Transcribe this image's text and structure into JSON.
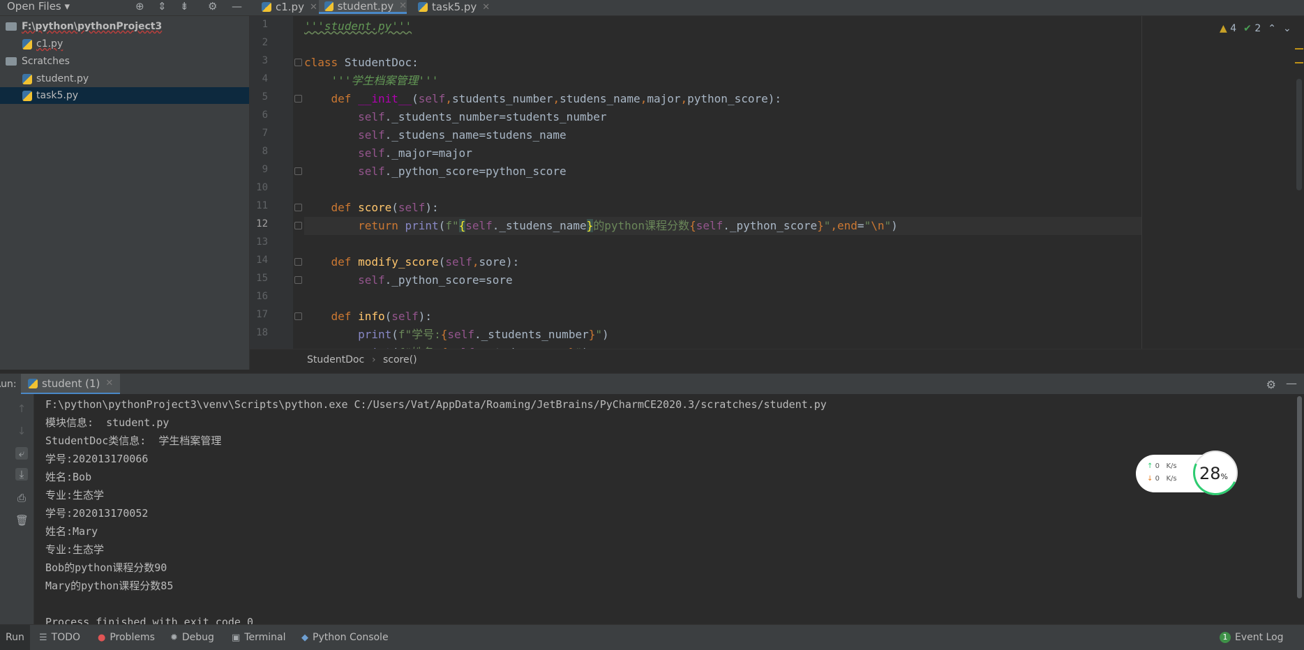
{
  "top": {
    "open_files_label": "Open Files"
  },
  "tabs": [
    {
      "label": "c1.py",
      "active": false
    },
    {
      "label": "student.py",
      "active": true
    },
    {
      "label": "task5.py",
      "active": false
    }
  ],
  "sidebar": {
    "items": [
      {
        "label": "F:\\python\\pythonProject3",
        "kind": "folder"
      },
      {
        "label": "c1.py",
        "kind": "file"
      },
      {
        "label": "Scratches",
        "kind": "folder"
      },
      {
        "label": "student.py",
        "kind": "file"
      },
      {
        "label": "task5.py",
        "kind": "file",
        "selected": true
      }
    ]
  },
  "inspections": {
    "warnings": "4",
    "weak_warnings": "2"
  },
  "editor": {
    "line_numbers": [
      "1",
      "2",
      "3",
      "4",
      "5",
      "6",
      "7",
      "8",
      "9",
      "10",
      "11",
      "12",
      "13",
      "14",
      "15",
      "16",
      "17",
      "18"
    ],
    "current_line": "12"
  },
  "breadcrumb": {
    "class_name": "StudentDoc",
    "method": "score()"
  },
  "run": {
    "label": "Run:",
    "tab_label": "student (1)",
    "output": [
      "F:\\python\\pythonProject3\\venv\\Scripts\\python.exe C:/Users/Vat/AppData/Roaming/JetBrains/PyCharmCE2020.3/scratches/student.py",
      "模块信息:  student.py",
      "StudentDoc类信息:  学生档案管理",
      "学号:202013170066",
      "姓名:Bob",
      "专业:生态学",
      "学号:202013170052",
      "姓名:Mary",
      "专业:生态学",
      "Bob的python课程分数90",
      "Mary的python课程分数85",
      "",
      "Process finished with exit code 0"
    ]
  },
  "network_widget": {
    "up": "0",
    "down": "0",
    "unit": "K/s",
    "percent": "28",
    "percent_sign": "%"
  },
  "bottom_bar": {
    "run": "Run",
    "todo": "TODO",
    "problems": "Problems",
    "debug": "Debug",
    "terminal": "Terminal",
    "python_console": "Python Console",
    "event_log": "Event Log",
    "event_log_count": "1"
  }
}
